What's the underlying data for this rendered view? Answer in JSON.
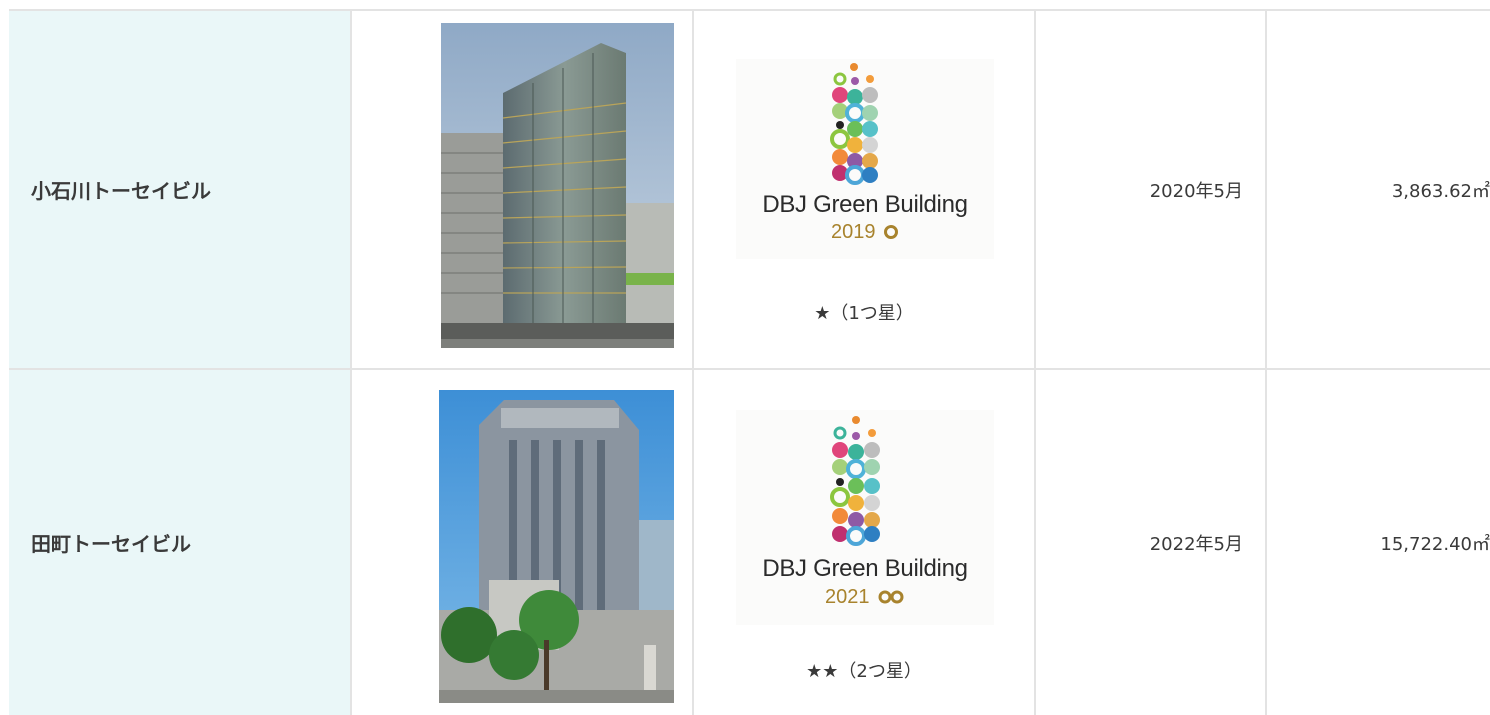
{
  "rows": [
    {
      "name": "小石川トーセイビル",
      "logo_text": "DBJ Green Building",
      "logo_year": "2019",
      "rating": "★（1つ星）",
      "date": "2020年5月",
      "area": "3,863.62㎡"
    },
    {
      "name": "田町トーセイビル",
      "logo_text": "DBJ Green Building",
      "logo_year": "2021",
      "rating": "★★（2つ星）",
      "date": "2022年5月",
      "area": "15,722.40㎡"
    }
  ],
  "colors": {
    "name_cell_bg": "#eaf7f8",
    "border": "#e3e3e3",
    "logo_gold": "#a8832d"
  }
}
